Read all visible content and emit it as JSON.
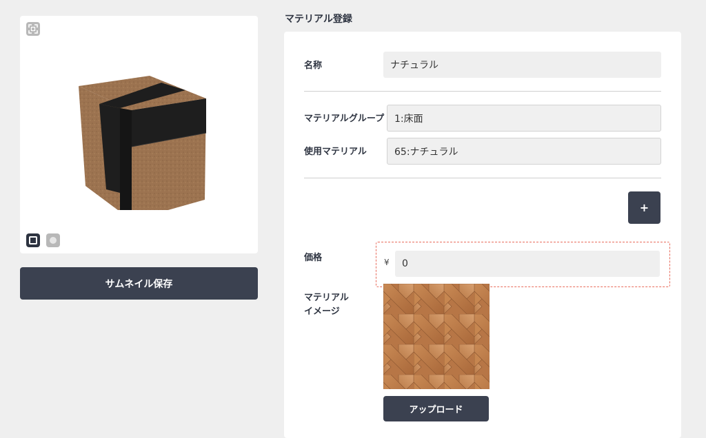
{
  "preview": {
    "save_thumbnail_label": "サムネイル保存"
  },
  "form": {
    "section_title": "マテリアル登録",
    "name_label": "名称",
    "name_value": "ナチュラル",
    "material_group_label": "マテリアルグループ",
    "material_group_value": "1:床面",
    "used_material_label": "使用マテリアル",
    "used_material_value": "65:ナチュラル",
    "add_button_label": "+",
    "price_label": "価格",
    "currency_symbol": "¥",
    "price_value": "0",
    "material_image_label_line1": "マテリアル",
    "material_image_label_line2": "イメージ",
    "upload_button_label": "アップロード"
  },
  "colors": {
    "button_bg": "#3b4150",
    "highlight_border": "#e86a5a",
    "page_bg": "#efefef"
  },
  "icons": {
    "fullscreen": "expand-icon",
    "view_mode_cube": "square-icon",
    "view_mode_sphere": "circle-icon"
  }
}
